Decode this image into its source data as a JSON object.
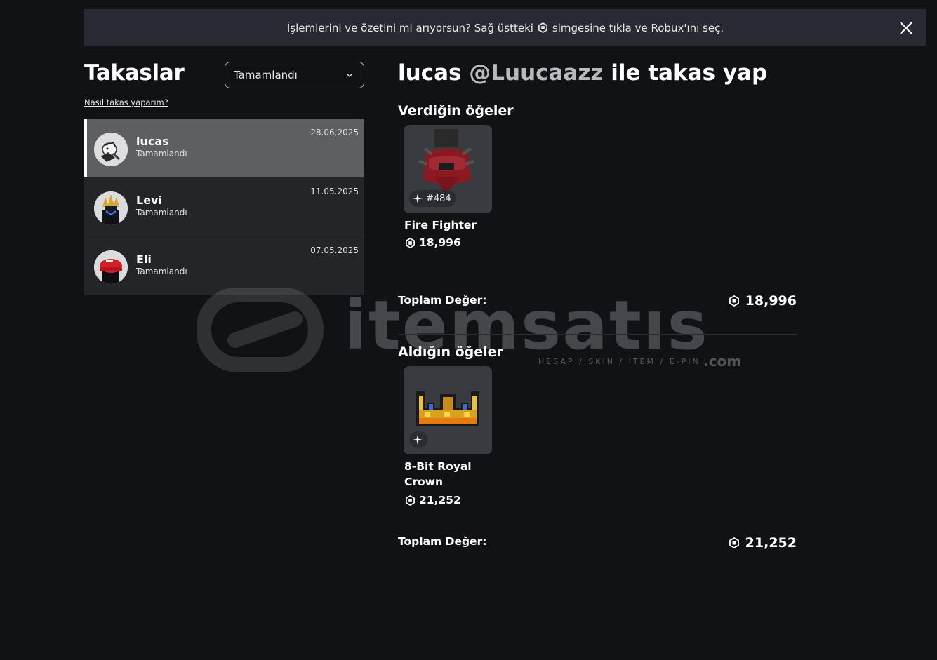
{
  "banner": {
    "text_before": "İşlemlerini ve özetini mi arıyorsun? Sağ üstteki",
    "text_after": "simgesine tıkla ve Robux'ını seç."
  },
  "sidebar": {
    "title": "Takaslar",
    "filter_value": "Tamamlandı",
    "help_link": "Nasıl takas yaparım?",
    "trades": [
      {
        "name": "lucas",
        "status": "Tamamlandı",
        "date": "28.06.2025"
      },
      {
        "name": "Levi",
        "status": "Tamamlandı",
        "date": "11.05.2025"
      },
      {
        "name": "Eli",
        "status": "Tamamlandı",
        "date": "07.05.2025"
      }
    ]
  },
  "trade": {
    "title_name": "lucas",
    "title_handle": "@Luucaazz",
    "title_suffix": "ile takas yap",
    "given": {
      "title": "Verdiğin öğeler",
      "items": [
        {
          "name": "Fire Fighter",
          "serial": "#484",
          "price": "18,996"
        }
      ],
      "total_label": "Toplam Değer:",
      "total_value": "18,996"
    },
    "received": {
      "title": "Aldığın öğeler",
      "items": [
        {
          "name": "8-Bit Royal Crown",
          "price": "21,252"
        }
      ],
      "total_label": "Toplam Değer:",
      "total_value": "21,252"
    }
  },
  "watermark": {
    "brand": "itemsatıs",
    "tagline": "HESAP / SKIN / ITEM / E-PIN",
    "suffix": ".com"
  },
  "icons": {
    "robux": "robux-icon",
    "close": "close-icon",
    "chevron": "chevron-down-icon",
    "limited": "limited-sparkle-icon"
  }
}
